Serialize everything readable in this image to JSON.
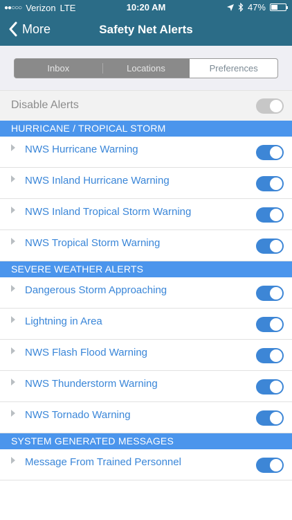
{
  "status": {
    "carrier": "Verizon",
    "network": "LTE",
    "time": "10:20 AM",
    "battery": "47%",
    "battery_level": 0.47
  },
  "nav": {
    "back_label": "More",
    "title": "Safety Net Alerts"
  },
  "tabs": [
    {
      "label": "Inbox",
      "active": false
    },
    {
      "label": "Locations",
      "active": false
    },
    {
      "label": "Preferences",
      "active": true
    }
  ],
  "disable_alerts": {
    "label": "Disable Alerts",
    "on": false
  },
  "sections": [
    {
      "title": "HURRICANE / TROPICAL STORM",
      "items": [
        {
          "label": "NWS Hurricane Warning",
          "on": true
        },
        {
          "label": "NWS Inland Hurricane Warning",
          "on": true
        },
        {
          "label": "NWS Inland Tropical Storm Warning",
          "on": true
        },
        {
          "label": "NWS Tropical Storm Warning",
          "on": true
        }
      ]
    },
    {
      "title": "SEVERE WEATHER ALERTS",
      "items": [
        {
          "label": "Dangerous Storm Approaching",
          "on": true
        },
        {
          "label": "Lightning in Area",
          "on": true
        },
        {
          "label": "NWS Flash Flood Warning",
          "on": true
        },
        {
          "label": "NWS Thunderstorm Warning",
          "on": true
        },
        {
          "label": "NWS Tornado Warning",
          "on": true
        }
      ]
    },
    {
      "title": "SYSTEM GENERATED MESSAGES",
      "items": [
        {
          "label": "Message From Trained Personnel",
          "on": true
        }
      ]
    }
  ],
  "colors": {
    "nav_bg": "#2b6c87",
    "section_bg": "#4b95ec",
    "link_text": "#3a86d8",
    "toggle_on": "#3d86d6",
    "toggle_off": "#c7c7c7"
  }
}
